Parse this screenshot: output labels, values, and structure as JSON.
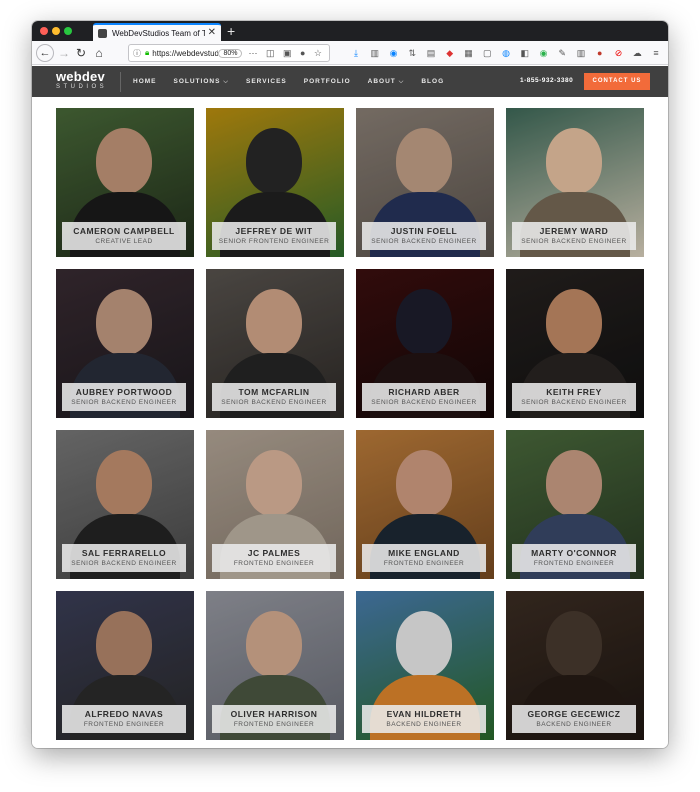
{
  "browser": {
    "tab_title": "WebDevStudios Team of Talent",
    "url": "https://webdevstudios.com/about/team/",
    "zoom": "80%"
  },
  "site": {
    "logo_main": "webdev",
    "logo_sub": "STUDIOS",
    "menu": [
      {
        "label": "HOME"
      },
      {
        "label": "SOLUTIONS"
      },
      {
        "label": "SERVICES"
      },
      {
        "label": "PORTFOLIO"
      },
      {
        "label": "ABOUT"
      },
      {
        "label": "BLOG"
      }
    ],
    "phone": "1-855-932-3380",
    "contact_label": "CONTACT US",
    "accent_color": "#f26b3a"
  },
  "team": [
    {
      "name": "CAMERON CAMPBELL",
      "role": "CREATIVE LEAD"
    },
    {
      "name": "JEFFREY DE WIT",
      "role": "SENIOR FRONTEND ENGINEER"
    },
    {
      "name": "JUSTIN FOELL",
      "role": "SENIOR BACKEND ENGINEER"
    },
    {
      "name": "JEREMY WARD",
      "role": "SENIOR BACKEND ENGINEER"
    },
    {
      "name": "AUBREY PORTWOOD",
      "role": "SENIOR BACKEND ENGINEER"
    },
    {
      "name": "TOM MCFARLIN",
      "role": "SENIOR BACKEND ENGINEER"
    },
    {
      "name": "RICHARD ABER",
      "role": "SENIOR BACKEND ENGINEER"
    },
    {
      "name": "KEITH FREY",
      "role": "SENIOR BACKEND ENGINEER"
    },
    {
      "name": "SAL FERRARELLO",
      "role": "SENIOR BACKEND ENGINEER"
    },
    {
      "name": "JC PALMES",
      "role": "FRONTEND ENGINEER"
    },
    {
      "name": "MIKE ENGLAND",
      "role": "FRONTEND ENGINEER"
    },
    {
      "name": "MARTY O'CONNOR",
      "role": "FRONTEND ENGINEER"
    },
    {
      "name": "ALFREDO NAVAS",
      "role": "FRONTEND ENGINEER"
    },
    {
      "name": "OLIVER HARRISON",
      "role": "FRONTEND ENGINEER"
    },
    {
      "name": "EVAN HILDRETH",
      "role": "BACKEND ENGINEER"
    },
    {
      "name": "GEORGE GECEWICZ",
      "role": "BACKEND ENGINEER"
    }
  ]
}
